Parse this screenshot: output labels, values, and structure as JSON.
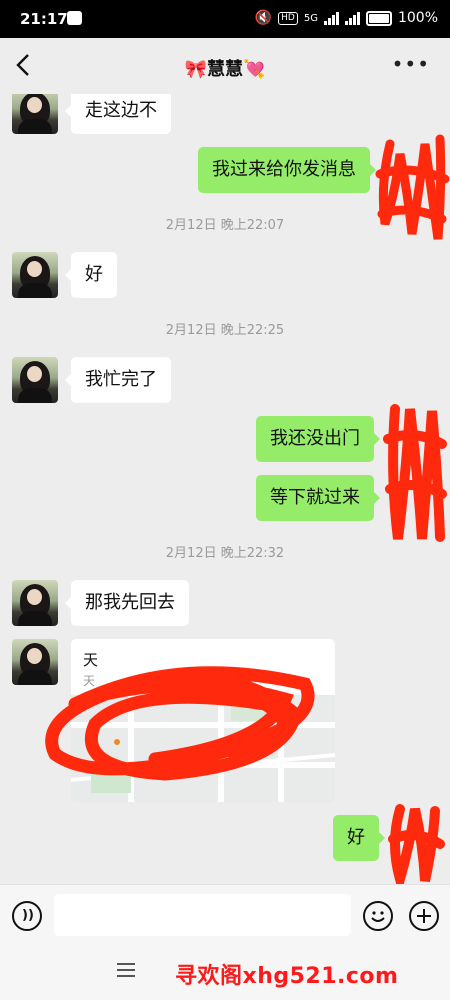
{
  "status_bar": {
    "time": "21:17",
    "network": "5G",
    "hd": "HD",
    "battery": "100%"
  },
  "header": {
    "title": "🎀慧慧💘"
  },
  "messages": [
    {
      "side": "in",
      "text": "走这边不"
    },
    {
      "side": "out",
      "text": "我过来给你发消息"
    },
    {
      "timestamp": "2月12日 晚上22:07"
    },
    {
      "side": "in",
      "text": "好"
    },
    {
      "timestamp": "2月12日 晚上22:25"
    },
    {
      "side": "in",
      "text": "我忙完了"
    },
    {
      "side": "out",
      "text": "我还没出门"
    },
    {
      "side": "out",
      "text": "等下就过来"
    },
    {
      "timestamp": "2月12日 晚上22:32"
    },
    {
      "side": "in",
      "text": "那我先回去"
    },
    {
      "side": "in",
      "type": "location",
      "title": "天",
      "address": "天"
    },
    {
      "side": "out",
      "text": "好"
    }
  ],
  "watermark": "寻欢阁xhg521.com",
  "colors": {
    "out_bubble": "#95ec69",
    "in_bubble": "#ffffff",
    "background": "#ededed",
    "scribble": "#ff2a0d"
  }
}
